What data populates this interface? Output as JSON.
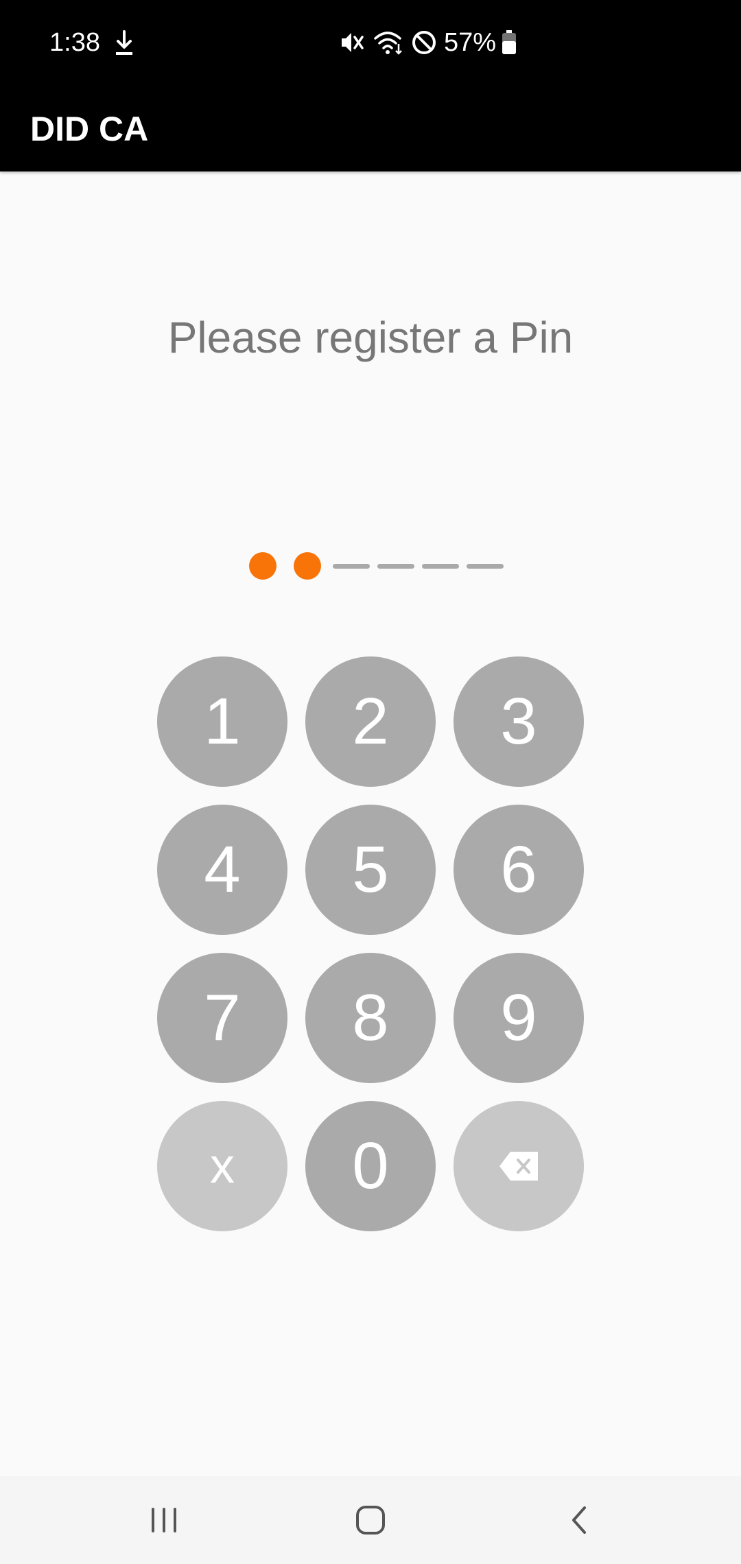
{
  "status_bar": {
    "time": "1:38",
    "battery": "57%",
    "icons": [
      "download-icon",
      "mute-icon",
      "wifi-icon",
      "do-not-disturb-icon",
      "battery-icon"
    ]
  },
  "app_bar": {
    "title": "DID CA"
  },
  "prompt": "Please register a Pin",
  "pin": {
    "length": 6,
    "entered": 2,
    "accent_color": "#f87408",
    "empty_color": "#a9a9a9"
  },
  "keypad": {
    "keys": [
      {
        "label": "1",
        "name": "key-1"
      },
      {
        "label": "2",
        "name": "key-2"
      },
      {
        "label": "3",
        "name": "key-3"
      },
      {
        "label": "4",
        "name": "key-4"
      },
      {
        "label": "5",
        "name": "key-5"
      },
      {
        "label": "6",
        "name": "key-6"
      },
      {
        "label": "7",
        "name": "key-7"
      },
      {
        "label": "8",
        "name": "key-8"
      },
      {
        "label": "9",
        "name": "key-9"
      },
      {
        "label": "x",
        "name": "key-cancel"
      },
      {
        "label": "0",
        "name": "key-0"
      },
      {
        "label": "",
        "name": "key-backspace",
        "icon": "backspace-icon"
      }
    ],
    "key_color": "#aaaaaa",
    "secondary_key_color": "#c7c7c7"
  },
  "nav_bar": {
    "buttons": [
      "recent-apps-icon",
      "home-icon",
      "back-icon"
    ]
  }
}
